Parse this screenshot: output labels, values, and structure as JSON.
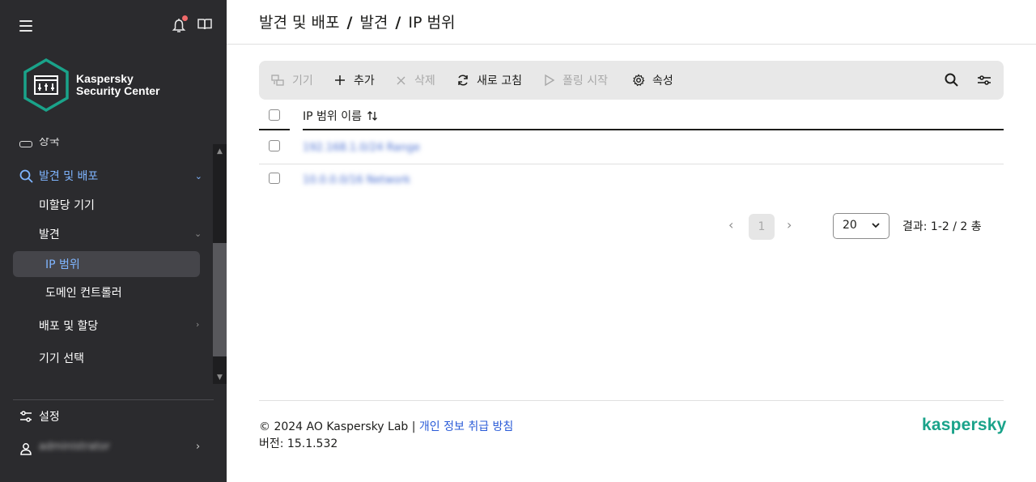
{
  "sidebar": {
    "logo_line1": "Kaspersky",
    "logo_line2": "Security Center",
    "clipped_item_label": "상국",
    "discovery_label": "발견 및 배포",
    "items": {
      "unassigned": "미할당 기기",
      "discovery": "발견",
      "ip_ranges": "IP 범위",
      "domain_controllers": "도메인 컨트롤러",
      "deploy_assign": "배포 및 할당",
      "device_selection": "기기 선택"
    },
    "settings_label": "설정",
    "user_label": "administrator"
  },
  "breadcrumb": {
    "part1": "발견 및 배포",
    "sep": "/",
    "part2": "발견",
    "part3": "IP 범위"
  },
  "toolbar": {
    "devices": "기기",
    "add": "추가",
    "delete": "삭제",
    "refresh": "새로 고침",
    "start_poll": "폴링 시작",
    "properties": "속성"
  },
  "table": {
    "column_name": "IP 범위 이름",
    "rows": [
      {
        "name": "192.168.1.0/24 Range"
      },
      {
        "name": "10.0.0.0/16 Network"
      }
    ]
  },
  "pagination": {
    "current_page": "1",
    "page_size": "20",
    "results": "결과: 1-2 / 2 총"
  },
  "footer": {
    "copyright": "© 2024 AO Kaspersky Lab | ",
    "privacy_link": "개인 정보 취급 방침",
    "version": "버전: 15.1.532",
    "brand": "kaspersky"
  },
  "colors": {
    "sidebar_bg": "#2b2b2e",
    "accent_blue": "#7fb5ff",
    "brand_green": "#1aa38a",
    "notification_dot": "#f06a6a"
  }
}
